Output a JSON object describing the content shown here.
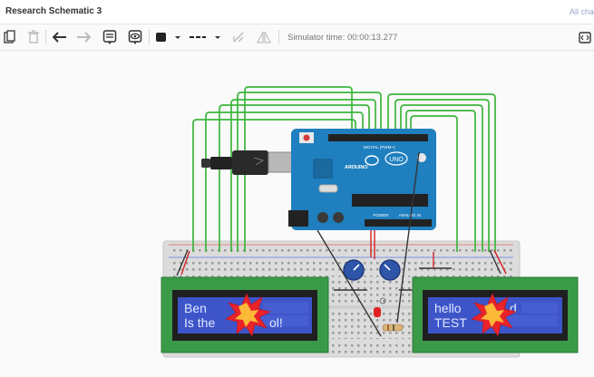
{
  "app": {
    "title": "Research Schematic 3",
    "all_changes": "All cha"
  },
  "toolbar": {
    "tools": [
      {
        "name": "paste-icon"
      },
      {
        "name": "delete-icon"
      },
      {
        "name": "undo-icon"
      },
      {
        "name": "redo-icon"
      },
      {
        "name": "notes-icon"
      },
      {
        "name": "view-icon"
      },
      {
        "name": "color-picker"
      },
      {
        "name": "line-style-picker"
      },
      {
        "name": "rotate-icon"
      },
      {
        "name": "flip-icon"
      }
    ],
    "simulator_time": "Simulator time: 00:00:13.277",
    "code_icon": "code-icon"
  },
  "circuit": {
    "arduino": {
      "brand": "ARDUINO",
      "model": "UNO",
      "digital_label": "DIGITAL (PWM~)",
      "power_label": "POWER",
      "analog_label": "ANALOG IN"
    },
    "lcd_left": {
      "line1": "Ben",
      "line2": "Is the",
      "line2_tail": "ol!"
    },
    "lcd_right": {
      "line1": "hello",
      "line1_tail": "d",
      "line2": "TEST"
    },
    "colors": {
      "wire_green": "#3cb53c",
      "wire_dark": "#333333",
      "wire_red": "#d22222",
      "arduino_blue": "#1f7fbf",
      "lcd_green": "#3a9a48",
      "lcd_screen": "#3e55c9",
      "explosion": "#e8232a"
    }
  }
}
